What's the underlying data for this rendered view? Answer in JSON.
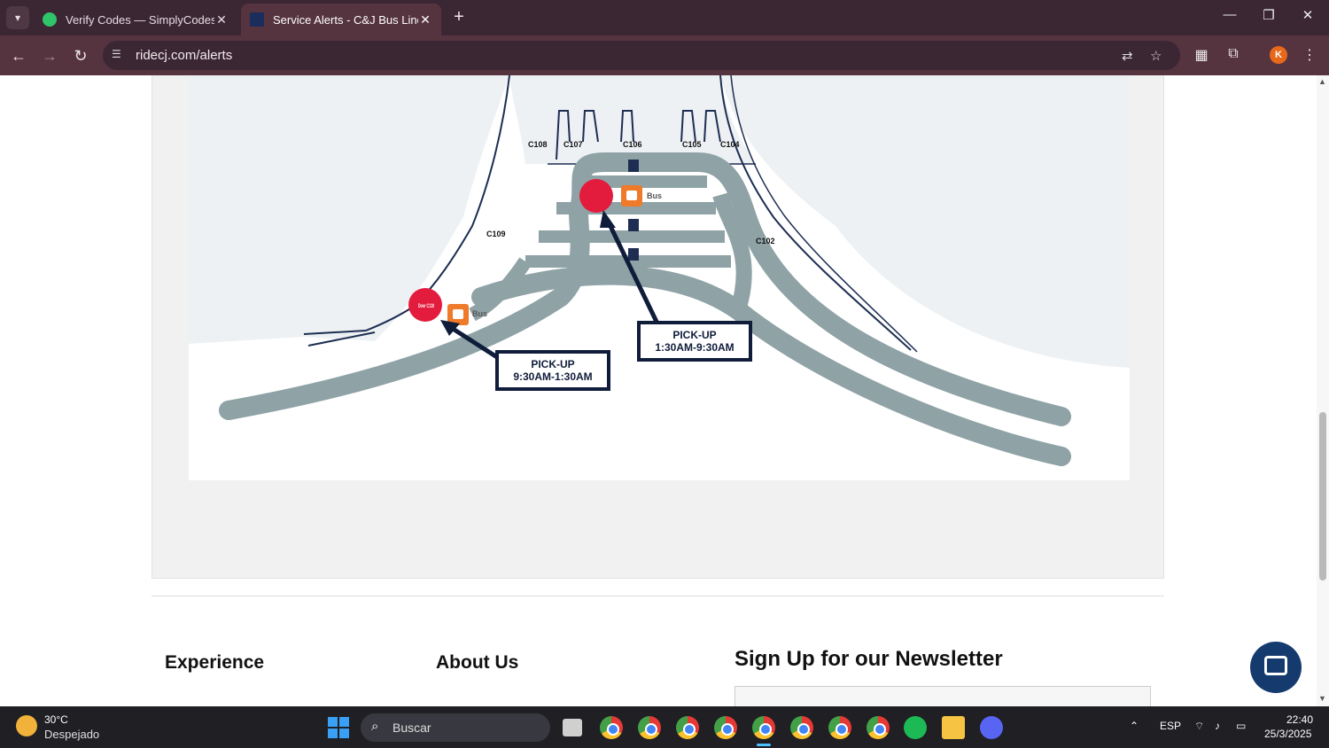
{
  "browser": {
    "tabs": [
      {
        "title": "Verify Codes — SimplyCodes",
        "active": false
      },
      {
        "title": "Service Alerts - C&J Bus Lines",
        "active": true
      }
    ],
    "url": "ridecj.com/alerts",
    "profile_initial": "K"
  },
  "map": {
    "gates": [
      "C108",
      "C107",
      "C106",
      "C105",
      "C104",
      "C109",
      "C102"
    ],
    "door_label": "Door C110",
    "bus_label": "Bus",
    "pickup_1": {
      "title": "PICK-UP",
      "time": "1:30AM-9:30AM"
    },
    "pickup_2": {
      "title": "PICK-UP",
      "time": "9:30AM-1:30AM"
    }
  },
  "footer": {
    "col1_title": "Experience",
    "col2_title": "About Us",
    "newsletter_title": "Sign Up for our Newsletter"
  },
  "taskbar": {
    "weather_temp": "30°C",
    "weather_desc": "Despejado",
    "search_placeholder": "Buscar",
    "lang": "ESP",
    "time": "22:40",
    "date": "25/3/2025"
  }
}
